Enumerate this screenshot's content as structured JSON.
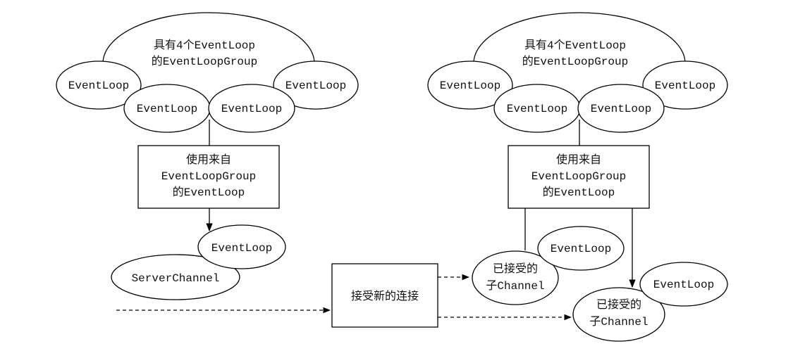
{
  "colors": {
    "stroke": "#000000",
    "fill": "#ffffff",
    "text": "#111111"
  },
  "left": {
    "group_label_line1": "具有4个EventLoop",
    "group_label_line2": "的EventLoopGroup",
    "loop_outer_left": "EventLoop",
    "loop_outer_right": "EventLoop",
    "loop_inner_left": "EventLoop",
    "loop_inner_right": "EventLoop",
    "box_line1": "使用来自",
    "box_line2": "EventLoopGroup",
    "box_line3": "的EventLoop",
    "assigned_loop": "EventLoop",
    "server_channel": "ServerChannel"
  },
  "right": {
    "group_label_line1": "具有4个EventLoop",
    "group_label_line2": "的EventLoopGroup",
    "loop_outer_left": "EventLoop",
    "loop_outer_right": "EventLoop",
    "loop_inner_left": "EventLoop",
    "loop_inner_right": "EventLoop",
    "box_line1": "使用来自",
    "box_line2": "EventLoopGroup",
    "box_line3": "的EventLoop",
    "child1_loop": "EventLoop",
    "child1_line1": "已接受的",
    "child1_line2": "子Channel",
    "child2_loop": "EventLoop",
    "child2_line1": "已接受的",
    "child2_line2": "子Channel"
  },
  "accept": {
    "label": "接受新的连接"
  }
}
